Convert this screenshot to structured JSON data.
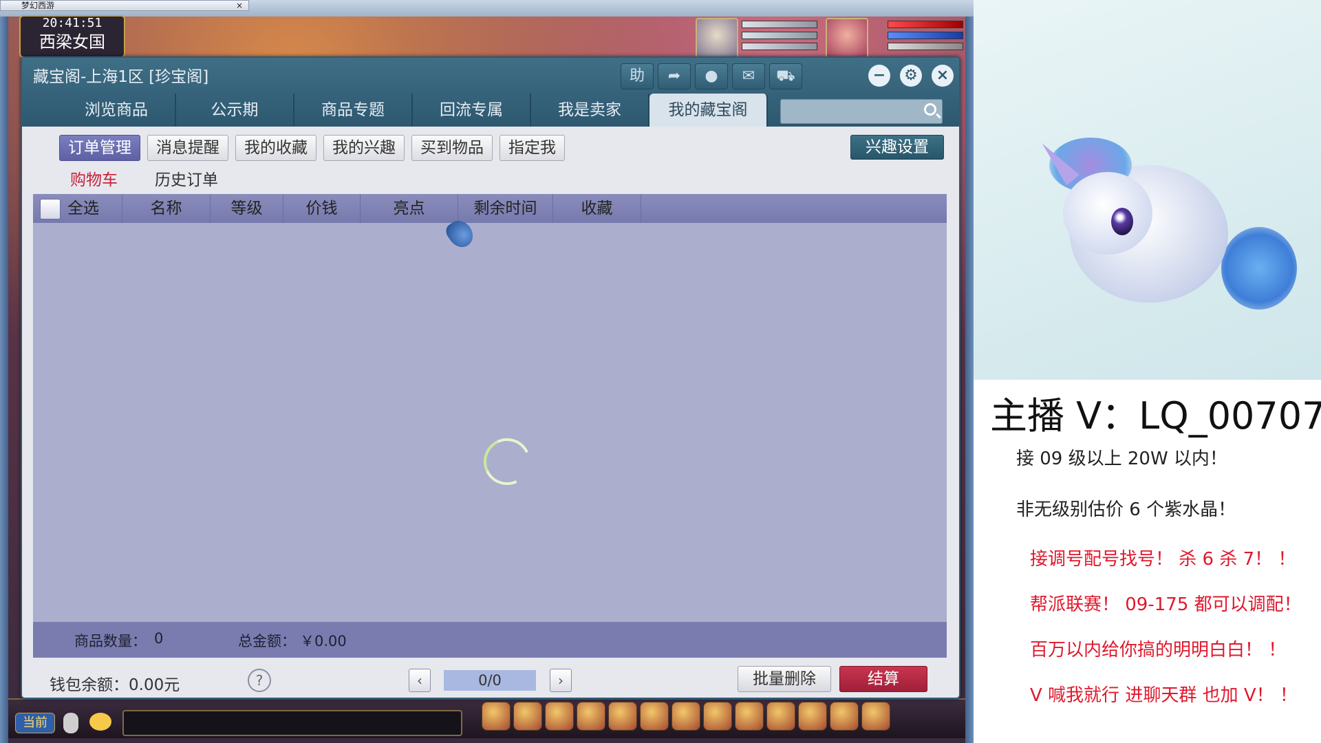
{
  "game": {
    "tab_title": "梦幻西游",
    "clock": "20:41:51",
    "location": "西梁女国",
    "chat_channel": "当前"
  },
  "dialog": {
    "title": "藏宝阁-上海1区 [珍宝阁]",
    "header_buttons": [
      {
        "icon": "help-icon",
        "label": "助"
      },
      {
        "icon": "share-icon",
        "label": ""
      },
      {
        "icon": "record-icon",
        "label": ""
      },
      {
        "icon": "chat-icon",
        "label": ""
      },
      {
        "icon": "cart-icon",
        "label": ""
      }
    ],
    "window_buttons": [
      "minimize-icon",
      "settings-icon",
      "close-icon"
    ],
    "main_tabs": [
      {
        "label": "浏览商品",
        "active": false
      },
      {
        "label": "公示期",
        "active": false
      },
      {
        "label": "商品专题",
        "active": false
      },
      {
        "label": "回流专属",
        "active": false
      },
      {
        "label": "我是卖家",
        "active": false
      },
      {
        "label": "我的藏宝阁",
        "active": true
      }
    ],
    "search": {
      "value": "",
      "placeholder": ""
    },
    "sub_tabs": [
      {
        "label": "订单管理",
        "active": true
      },
      {
        "label": "消息提醒",
        "active": false
      },
      {
        "label": "我的收藏",
        "active": false
      },
      {
        "label": "我的兴趣",
        "active": false
      },
      {
        "label": "买到物品",
        "active": false
      },
      {
        "label": "指定我",
        "active": false
      }
    ],
    "interest_settings_label": "兴趣设置",
    "order_tabs": [
      {
        "label": "购物车",
        "active": true
      },
      {
        "label": "历史订单",
        "active": false
      }
    ],
    "table": {
      "select_all_label": "全选",
      "columns": [
        "名称",
        "等级",
        "价钱",
        "亮点",
        "剩余时间",
        "收藏"
      ],
      "rows": []
    },
    "footer": {
      "item_count_label": "商品数量：",
      "item_count": "0",
      "total_label": "总金额：",
      "total": "￥0.00"
    },
    "wallet": "钱包余额：0.00元",
    "help": "?",
    "page": "0/0",
    "batch_delete_label": "批量删除",
    "checkout_label": "结算"
  },
  "side_panel": {
    "streamer": "主播 V：LQ_00707",
    "lines": [
      {
        "text": "接 09 级以上 20W 以内！",
        "color": "black"
      },
      {
        "text": "非无级别估价 6 个紫水晶！",
        "color": "black"
      },
      {
        "text": "接调号配号找号！ 杀 6 杀 7！ ！",
        "color": "red"
      },
      {
        "text": "帮派联赛！ 09-175 都可以调配！",
        "color": "red"
      },
      {
        "text": "百万以内给你搞的明明白白！ ！",
        "color": "red"
      },
      {
        "text": "V 喊我就行  进聊天群 也加 V！ ！",
        "color": "red"
      }
    ]
  },
  "colors": {
    "dialog_header": "#2d5870",
    "table_bg": "#acaecd",
    "active_sub_tab": "#5d60a4",
    "checkout": "#a01f39",
    "red_text": "#e0182c"
  }
}
